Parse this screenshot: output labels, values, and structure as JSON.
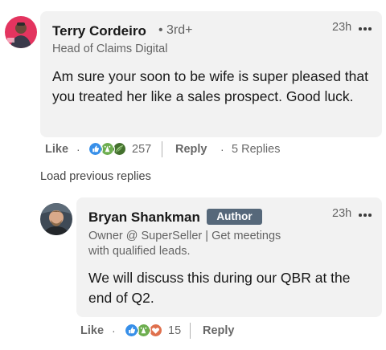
{
  "comment": {
    "author": "Terry Cordeiro",
    "degree": "• 3rd+",
    "headline": "Head of Claims Digital",
    "time": "23h",
    "text": "Am sure your soon to be wife is super pleased that you treated her like a sales prospect. Good luck.",
    "like_label": "Like",
    "reaction_count": "257",
    "reply_label": "Reply",
    "replies_count": "5 Replies",
    "reactions": [
      "like-icon",
      "celebrate-icon",
      "insightful-icon"
    ],
    "separator": "·"
  },
  "load_previous": "Load previous replies",
  "reply": {
    "author": "Bryan Shankman",
    "badge": "Author",
    "headline": "Owner @ SuperSeller | Get meetings with qualified leads.",
    "time": "23h",
    "text": "We will discuss this during our QBR at the end of Q2.",
    "like_label": "Like",
    "reaction_count": "15",
    "reply_label": "Reply",
    "reactions": [
      "like-icon",
      "celebrate-icon",
      "love-icon"
    ],
    "separator": "·"
  },
  "colors": {
    "bubble": "#f2f2f2",
    "like": "#378fe9",
    "celebrate": "#44712e",
    "love": "#df704d",
    "badge": "#56687a",
    "avatar_terry": "#e3345f"
  }
}
